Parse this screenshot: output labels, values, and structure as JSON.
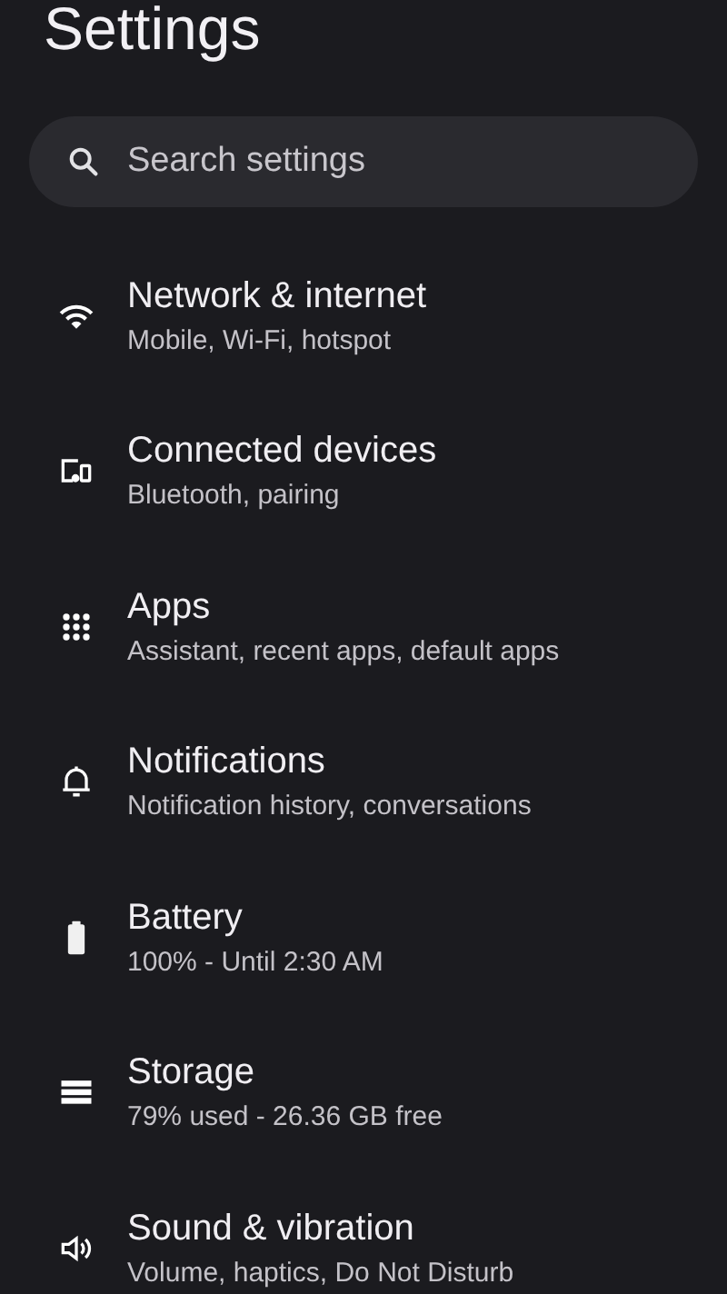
{
  "title": "Settings",
  "search": {
    "placeholder": "Search settings"
  },
  "items": [
    {
      "kind": "wifi",
      "title": "Network & internet",
      "subtitle": "Mobile, Wi-Fi, hotspot"
    },
    {
      "kind": "devices",
      "title": "Connected devices",
      "subtitle": "Bluetooth, pairing"
    },
    {
      "kind": "apps",
      "title": "Apps",
      "subtitle": "Assistant, recent apps, default apps"
    },
    {
      "kind": "bell",
      "title": "Notifications",
      "subtitle": "Notification history, conversations"
    },
    {
      "kind": "battery",
      "title": "Battery",
      "subtitle": "100% - Until 2:30 AM"
    },
    {
      "kind": "storage",
      "title": "Storage",
      "subtitle": "79% used - 26.36 GB free"
    },
    {
      "kind": "sound",
      "title": "Sound & vibration",
      "subtitle": "Volume, haptics, Do Not Disturb"
    }
  ]
}
